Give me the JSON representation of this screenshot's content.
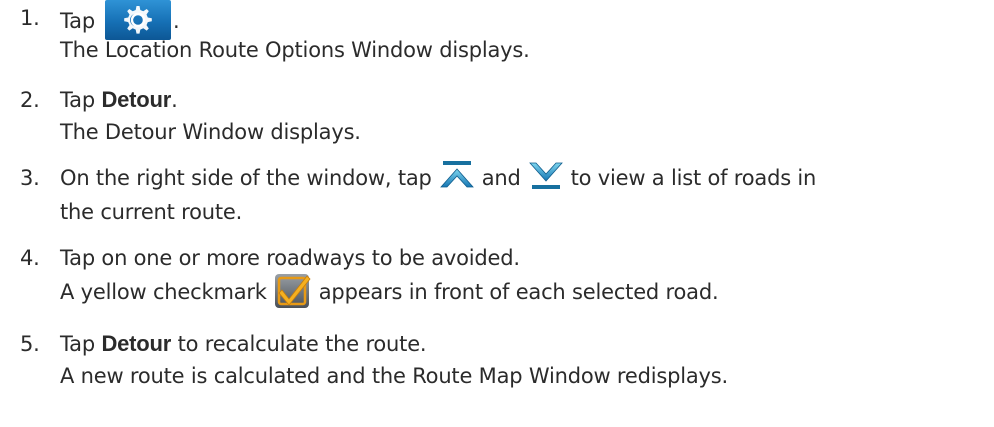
{
  "steps": [
    {
      "number": "1.",
      "pre": "Tap",
      "icon": "gear-icon",
      "post": ".",
      "result": "The Location Route Options Window displays."
    },
    {
      "number": "2.",
      "pre": "Tap ",
      "bold": "Detour",
      "post": ".",
      "result": "The Detour Window displays."
    },
    {
      "number": "3.",
      "pre": "On the right side of the window, tap",
      "icon_up": "chevron-up-icon",
      "mid": "and",
      "icon_down": "chevron-down-icon",
      "post": "to view a list of roads in",
      "cont": "the current route."
    },
    {
      "number": "4.",
      "text": "Tap on one or more roadways to be avoided.",
      "result_pre": "A yellow checkmark",
      "icon": "checkmark-icon",
      "result_post": "appears in front of each selected road."
    },
    {
      "number": "5.",
      "pre": "Tap ",
      "bold": "Detour",
      "post": " to recalculate the route.",
      "result": "A new route is calculated and the Route Map Window redisplays."
    }
  ],
  "colors": {
    "text": "#2b2b2b",
    "icon_blue": "#1670b5",
    "icon_teal": "#22a9c9",
    "check_yellow": "#f2a81d"
  }
}
